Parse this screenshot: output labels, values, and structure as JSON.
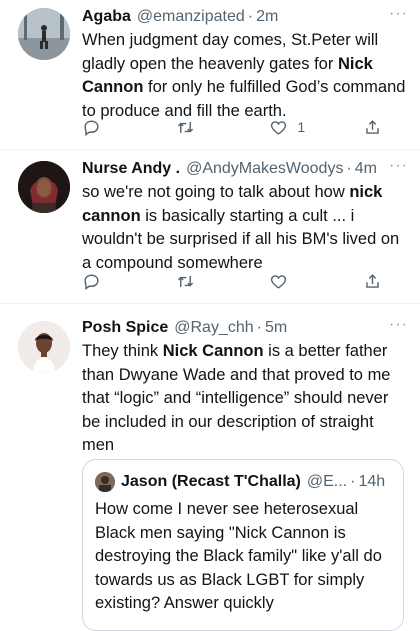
{
  "tweets": [
    {
      "name": "Agaba",
      "handle": "@emanzipated",
      "time": "2m",
      "text_parts": [
        "When judgment day comes, St.Peter will gladly open the heavenly gates for ",
        "Nick Cannon",
        " for only he fulfilled God’s command to produce and fill the earth."
      ],
      "likes": "1"
    },
    {
      "name": "Nurse Andy .",
      "handle": "@AndyMakesWoodys",
      "time": "4m",
      "text_parts": [
        "so we're not going to talk about how ",
        "nick cannon",
        " is basically starting a cult ... i wouldn't be surprised if all his BM's lived on a compound somewhere"
      ]
    },
    {
      "name": "Posh Spice",
      "handle": "@Ray_chh",
      "time": "5m",
      "text_parts": [
        "They think ",
        "Nick Cannon",
        " is a better father than Dwyane Wade and that proved to me that “logic” and “intelligence” should never be included in our description of straight men"
      ],
      "quote": {
        "name": "Jason (Recast T'Challa)",
        "handle": "@E...",
        "time": "14h",
        "text": "How come I never see heterosexual Black men saying \"Nick Cannon is destroying the Black family\" like y'all do towards us as Black LGBT for simply existing? Answer quickly"
      }
    }
  ],
  "icons": {
    "reply": "reply-icon",
    "retweet": "retweet-icon",
    "like": "heart-icon",
    "share": "share-icon",
    "more": "more-icon"
  },
  "ui": {
    "dot": "·",
    "more": "···"
  }
}
